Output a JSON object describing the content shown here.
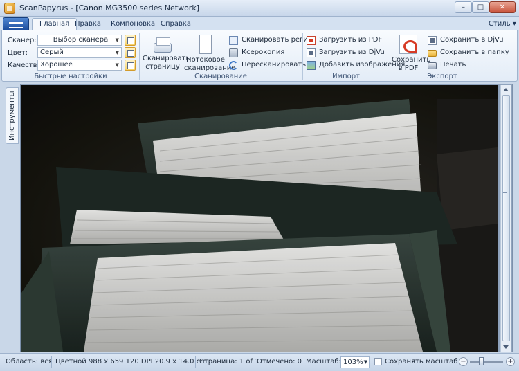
{
  "window": {
    "title": "ScanPapyrus - [Canon MG3500 series Network]",
    "min_label": "–",
    "max_label": "□",
    "close_label": "✕"
  },
  "tabs": [
    "Главная",
    "Правка",
    "Компоновка",
    "Справка"
  ],
  "style_menu": "Стиль ▾",
  "quick": {
    "scanner_label": "Сканер:",
    "scanner_value": "Выбор сканера",
    "color_label": "Цвет:",
    "color_value": "Серый",
    "quality_label": "Качество:",
    "quality_value": "Хорошее",
    "group": "Быстрые настройки"
  },
  "scan": {
    "scan_page": [
      "Сканировать",
      "страницу"
    ],
    "batch_scan": [
      "Потоковое",
      "сканирование"
    ],
    "scan_region": "Сканировать регион",
    "photocopy": "Ксерокопия",
    "rescan": "Пересканировать",
    "group": "Сканирование"
  },
  "import": {
    "load_pdf": "Загрузить из PDF",
    "load_djvu": "Загрузить из DjVu",
    "add_images": "Добавить изображения",
    "group": "Импорт"
  },
  "export": {
    "save_pdf": [
      "Сохранить",
      "в PDF"
    ],
    "save_djvu": "Сохранить в DjVu",
    "save_folder": "Сохранить в папку",
    "print": "Печать",
    "group": "Экспорт"
  },
  "side_tab": "Инструменты",
  "status": {
    "area": "Область: вся",
    "color_info": "Цветной  988 x 659  120 DPI  20.9 x 14.0 cm",
    "page": "Страница: 1 of 1",
    "marked": "Отмечено: 0",
    "zoom_label": "Масштаб:",
    "zoom_value": "103%",
    "keep_zoom": "Сохранять масштаб"
  }
}
